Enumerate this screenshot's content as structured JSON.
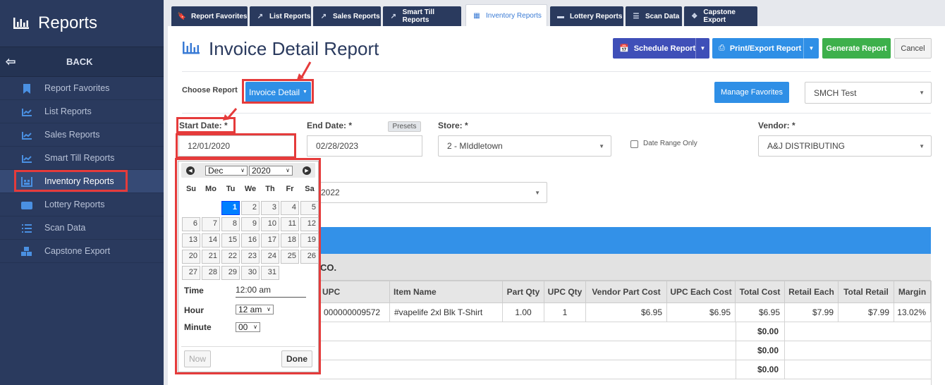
{
  "sidebar": {
    "title": "Reports",
    "back_label": "BACK",
    "items": [
      {
        "label": "Report Favorites",
        "icon": "bookmark-icon"
      },
      {
        "label": "List Reports",
        "icon": "line-chart-icon"
      },
      {
        "label": "Sales Reports",
        "icon": "line-chart-icon"
      },
      {
        "label": "Smart Till Reports",
        "icon": "line-chart-icon"
      },
      {
        "label": "Inventory Reports",
        "icon": "warehouse-icon"
      },
      {
        "label": "Lottery Reports",
        "icon": "ticket-icon"
      },
      {
        "label": "Scan Data",
        "icon": "list-icon"
      },
      {
        "label": "Capstone Export",
        "icon": "cubes-icon"
      }
    ],
    "active_index": 4
  },
  "tabs": [
    {
      "label": "Report Favorites"
    },
    {
      "label": "List Reports"
    },
    {
      "label": "Sales Reports"
    },
    {
      "label": "Smart Till Reports"
    },
    {
      "label": "Inventory Reports"
    },
    {
      "label": "Lottery Reports"
    },
    {
      "label": "Scan Data"
    },
    {
      "label": "Capstone Export"
    }
  ],
  "active_tab": 4,
  "page": {
    "title": "Invoice Detail Report",
    "schedule_label": "Schedule Report",
    "print_label": "Print/Export Report",
    "generate_label": "Generate Report",
    "cancel_label": "Cancel",
    "choose_report_label": "Choose Report",
    "choose_report_value": "Invoice Detail",
    "manage_favorites_label": "Manage Favorites",
    "favorite_select_value": "SMCH Test"
  },
  "filters": {
    "start_date_label": "Start Date: *",
    "start_date_value": "12/01/2020",
    "end_date_label": "End Date: *",
    "end_date_value": "02/28/2023",
    "presets_label": "Presets",
    "store_label": "Store: *",
    "store_value": "2 - MIddletown",
    "date_range_only_label": "Date Range Only",
    "vendor_label": "Vendor: *",
    "vendor_value": "A&J DISTRIBUTING",
    "second_select_value": "2022"
  },
  "calendar": {
    "month": "Dec",
    "year": "2020",
    "days_of_week": [
      "Su",
      "Mo",
      "Tu",
      "We",
      "Th",
      "Fr",
      "Sa"
    ],
    "first_weekday": 2,
    "days_in_month": 31,
    "selected_day": 1,
    "time_label": "Time",
    "time_value": "12:00 am",
    "hour_label": "Hour",
    "hour_value": "12 am",
    "minute_label": "Minute",
    "minute_value": "00",
    "now_label": "Now",
    "done_label": "Done"
  },
  "grid": {
    "group_label": "CO.",
    "columns": [
      "UPC",
      "Item Name",
      "Part Qty",
      "UPC Qty",
      "Vendor Part Cost",
      "UPC Each Cost",
      "Total Cost",
      "Retail Each",
      "Total Retail",
      "Margin"
    ],
    "row": [
      "000000009572",
      "#vapelife 2xl Blk T-Shirt",
      "1.00",
      "1",
      "$6.95",
      "$6.95",
      "$6.95",
      "$7.99",
      "$7.99",
      "13.02%"
    ],
    "subtotals": [
      "$0.00",
      "$0.00",
      "$0.00"
    ]
  }
}
